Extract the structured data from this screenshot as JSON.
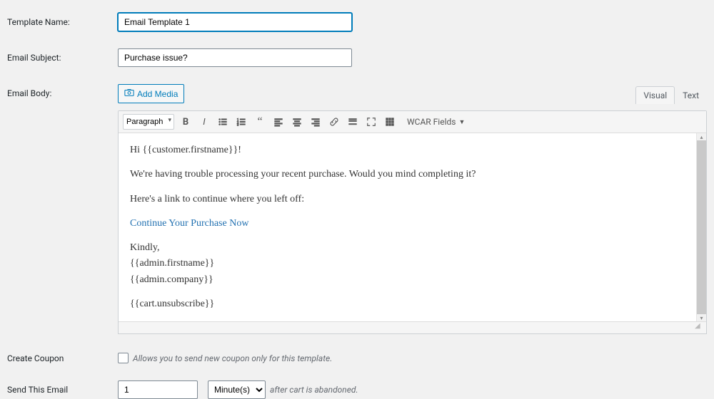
{
  "labels": {
    "template_name": "Template Name:",
    "email_subject": "Email Subject:",
    "email_body": "Email Body:",
    "create_coupon": "Create Coupon",
    "send_this_email": "Send This Email"
  },
  "fields": {
    "template_name_value": "Email Template 1",
    "email_subject_value": "Purchase issue?",
    "send_value": "1",
    "send_unit": "Minute(s)"
  },
  "buttons": {
    "add_media": "Add Media"
  },
  "tabs": {
    "visual": "Visual",
    "text": "Text"
  },
  "toolbar": {
    "format_select": "Paragraph",
    "wcar_fields": "WCAR Fields"
  },
  "body": {
    "line1": "Hi {{customer.firstname}}!",
    "line2": "We're having trouble processing your recent purchase. Would you mind completing it?",
    "line3": "Here's a link to continue where you left off:",
    "link": "Continue Your Purchase Now",
    "line5": "Kindly,",
    "line6": "{{admin.firstname}}",
    "line7": "{{admin.company}}",
    "line8": "{{cart.unsubscribe}}"
  },
  "hints": {
    "coupon": "Allows you to send new coupon only for this template.",
    "after_cart": "after cart is abandoned."
  }
}
